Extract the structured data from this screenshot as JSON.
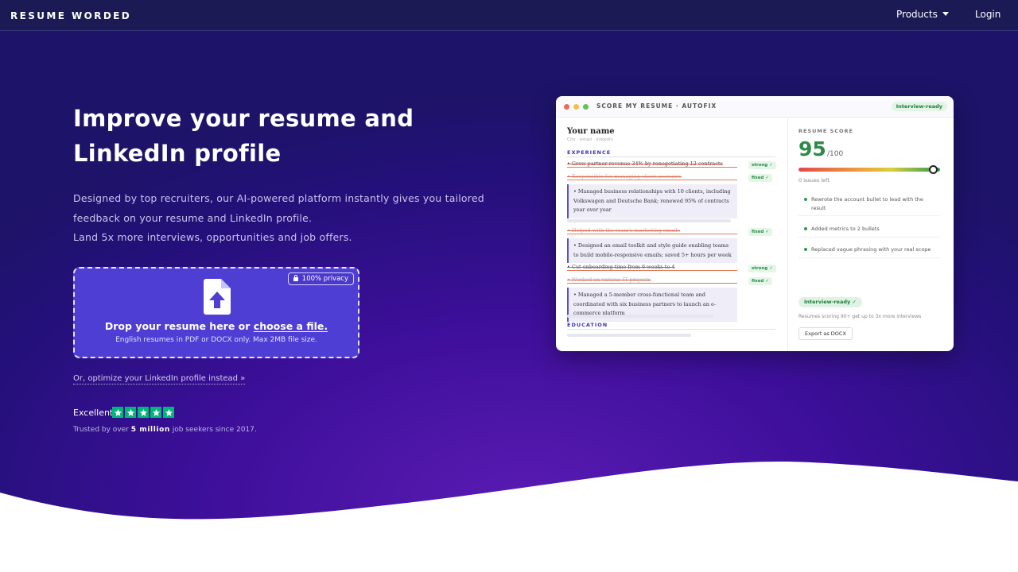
{
  "nav": {
    "brand": "RESUME WORDED",
    "products": "Products",
    "login": "Login"
  },
  "hero": {
    "headline": "Improve your resume and LinkedIn profile",
    "sub_line1": "Designed by top recruiters, our AI-powered platform instantly gives you tailored feedback on your resume and LinkedIn profile.",
    "sub_line2": "Land 5x more interviews, opportunities and job offers."
  },
  "upload": {
    "privacy": "100% privacy",
    "title_prefix": "Drop your resume here or ",
    "title_link": "choose a file.",
    "note": "English resumes in PDF or DOCX only. Max 2MB file size."
  },
  "linkedin_link": "Or, optimize your LinkedIn profile instead »",
  "rating": {
    "label": "Excellent",
    "stars": 5,
    "trusted_prefix": "Trusted by over ",
    "trusted_bold": "5 million",
    "trusted_suffix": " job seekers since 2017."
  },
  "app": {
    "title": "SCORE MY RESUME · AUTOFIX",
    "status": "Interview-ready",
    "doc": {
      "name": "Your name",
      "contact": "City · email · linkedin",
      "experience": "EXPERIENCE",
      "education": "EDUCATION",
      "line1": "• Grew partner revenue 34% by renegotiating 12 contracts",
      "line2": "• Responsible for managing client accounts",
      "fix1": "• Managed business relationships with 10 clients, including Volkswagen and Deutsche Bank; renewed 95% of contracts year over year",
      "line3": "• Helped with the team's marketing emails",
      "fix2": "• Designed an email toolkit and style guide enabling teams to build mobile-responsive emails; saved 5+ hours per week",
      "line4": "• Cut onboarding time from 6 weeks to 4",
      "line5": "• Worked on various IT projects",
      "fix3": "• Managed a 5-member cross-functional team and coordinated with six business partners to launch an e-commerce platform",
      "tag_strong": "strong ✓",
      "tag_fixed": "fixed ✓"
    },
    "panel": {
      "label": "RESUME SCORE",
      "score": "95",
      "total": "/100",
      "score_fraction": 0.95,
      "issues": "0 issues left",
      "fixes": [
        "Rewrote the account bullet to lead with the result",
        "Added metrics to 2 bullets",
        "Replaced vague phrasing with your real scope"
      ],
      "pill": "Interview-ready ✓",
      "note": "Resumes scoring 90+ get up to 3x more interviews",
      "export": "Export as DOCX"
    }
  },
  "colors": {
    "accent": "#4f3ed4",
    "trustpilot": "#00b67a",
    "score_green": "#2e8a4a"
  }
}
